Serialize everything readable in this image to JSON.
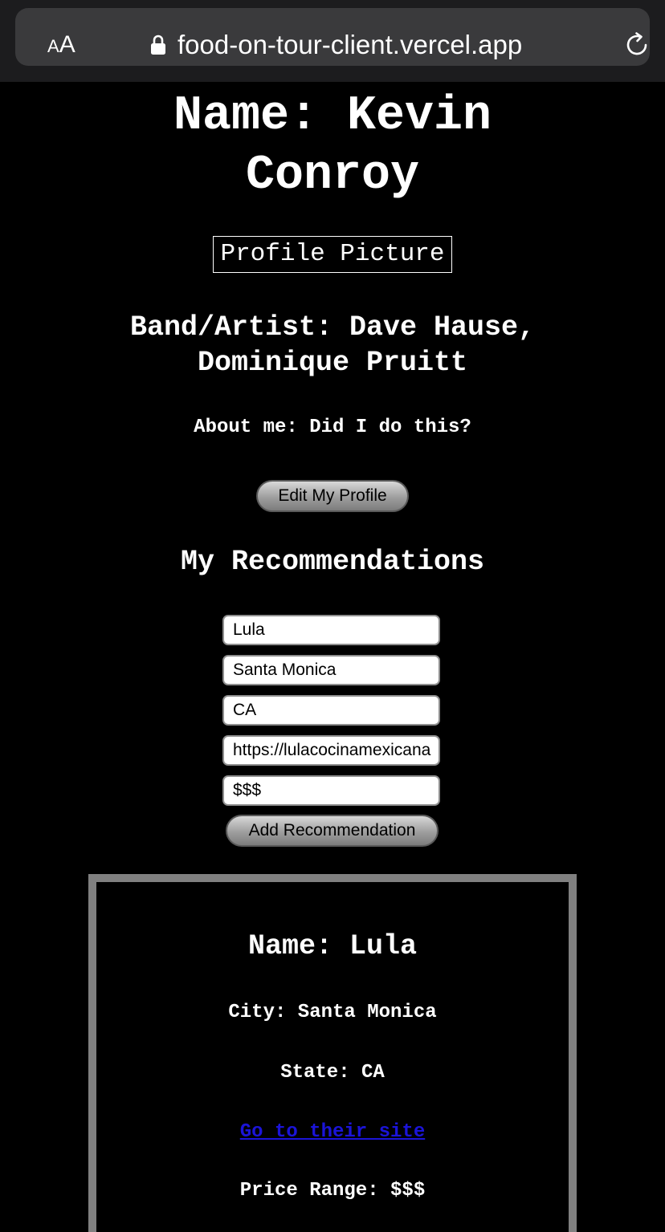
{
  "browser": {
    "text_size_small": "A",
    "text_size_large": "A",
    "url": "food-on-tour-client.vercel.app"
  },
  "profile": {
    "name_line1": "Name: Kevin",
    "name_line2": "Conroy",
    "picture_placeholder": "Profile Picture",
    "band_line1": "Band/Artist: Dave Hause,",
    "band_line2": "Dominique Pruitt",
    "about": "About me: Did I do this?",
    "edit_button": "Edit My Profile"
  },
  "recommendations": {
    "heading": "My Recommendations",
    "form": {
      "name_value": "Lula",
      "city_value": "Santa Monica",
      "state_value": "CA",
      "website_value": "https://lulacocinamexicana",
      "price_value": "$$$",
      "submit_label": "Add Recommendation"
    },
    "items": [
      {
        "name": "Name: Lula",
        "city": "City: Santa Monica",
        "state": "State: CA",
        "link_text": "Go to their site",
        "price": "Price Range: $$$"
      }
    ]
  }
}
